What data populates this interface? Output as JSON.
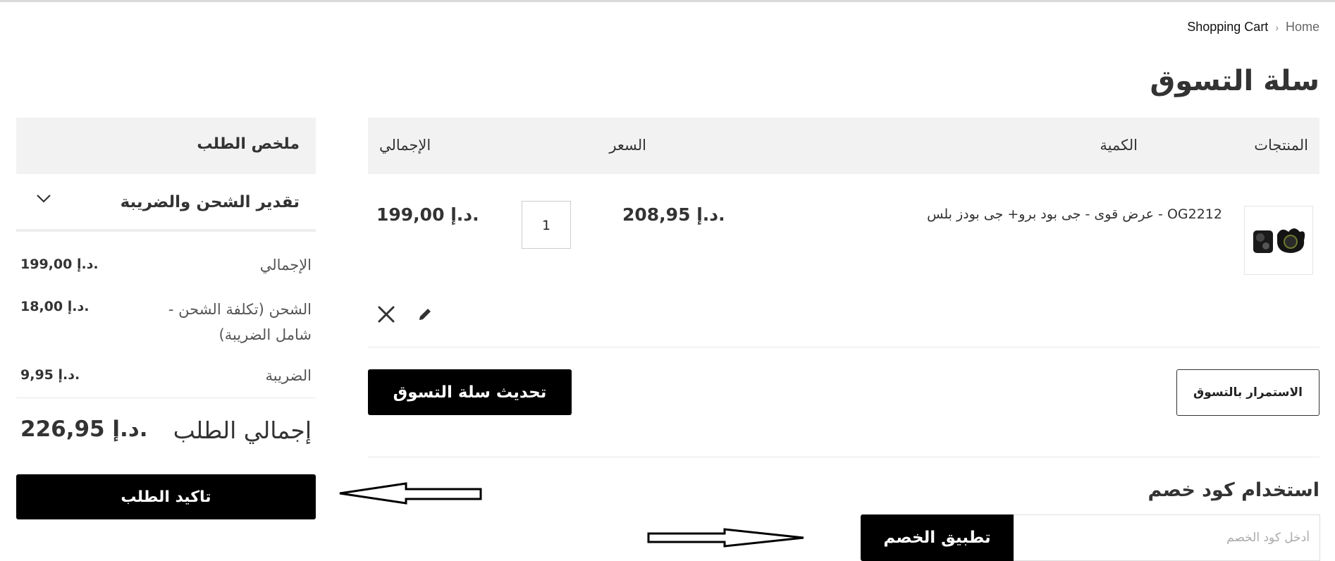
{
  "breadcrumb": {
    "current": "Shopping Cart",
    "home": "Home"
  },
  "page_title": "سلة التسوق",
  "table": {
    "headers": {
      "products": "المنتجات",
      "price": "السعر",
      "quantity": "الكمية",
      "total": "الإجمالي"
    },
    "items": [
      {
        "name": "OG2212 - عرض قوى - جى بود برو+ جى بودز بلس",
        "price": "208,95 د.إ.",
        "quantity": "1",
        "total": "199,00 د.إ."
      }
    ]
  },
  "buttons": {
    "update_cart": "تحديث سلة التسوق",
    "continue_shopping": "الاستمرار بالتسوق",
    "apply_discount": "تطبيق الخصم",
    "confirm_order": "تاكيد الطلب"
  },
  "discount": {
    "title": "استخدام كود خصم",
    "placeholder": "أدخل كود الخصم"
  },
  "summary": {
    "title": "ملخص الطلب",
    "shipping_estimate": "تقدير الشحن والضريبة",
    "subtotal_label": "الإجمالي",
    "subtotal_value": "199,00 د.إ.",
    "shipping_label": "الشحن (تكلفة الشحن - شامل الضريبة)",
    "shipping_value": "18,00 د.إ.",
    "tax_label": "الضريبة",
    "tax_value": "9,95 د.إ.",
    "order_total_label": "إجمالي الطلب",
    "order_total_value": "226,95 د.إ."
  },
  "icons": {
    "delete": "close-icon",
    "edit": "pencil-icon",
    "expand": "chevron-down-icon",
    "breadcrumb_sep": "chevron-right-icon"
  }
}
